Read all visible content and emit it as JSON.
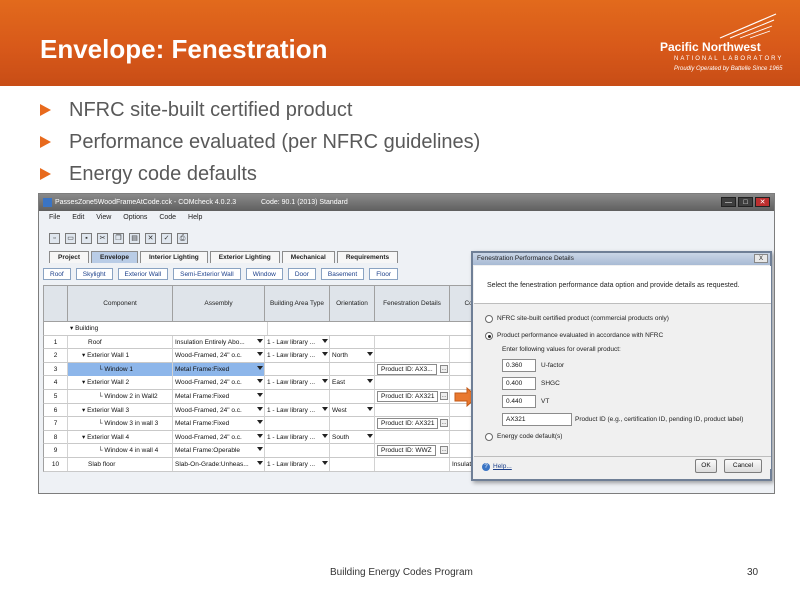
{
  "slide": {
    "title": "Envelope: Fenestration",
    "logo": {
      "name": "Pacific Northwest",
      "subtitle": "NATIONAL LABORATORY",
      "tagline": "Proudly Operated by Battelle Since 1965"
    },
    "bullets": [
      "NFRC site-built certified product",
      "Performance evaluated (per NFRC guidelines)",
      "Energy code defaults"
    ],
    "footer": "Building Energy Codes Program",
    "page_number": "30"
  },
  "app": {
    "window_title": "PassesZone5WoodFrameAtCode.cck - COMcheck 4.0.2.3",
    "code_label": "Code: 90.1 (2013) Standard",
    "window_buttons": [
      "—",
      "□",
      "✕"
    ],
    "menu": [
      "File",
      "Edit",
      "View",
      "Options",
      "Code",
      "Help"
    ],
    "toolbar_icons": [
      "new-icon",
      "open-icon",
      "save-icon",
      "cut-icon",
      "copy-icon",
      "paste-icon",
      "delete-icon",
      "check-icon",
      "print-icon"
    ],
    "tabs": [
      "Project",
      "Envelope",
      "Interior Lighting",
      "Exterior Lighting",
      "Mechanical",
      "Requirements"
    ],
    "active_tab": "Envelope",
    "subtabs": [
      "Roof",
      "Skylight",
      "Exterior Wall",
      "Semi-Exterior Wall",
      "Window",
      "Door",
      "Basement",
      "Floor"
    ],
    "table": {
      "headers": [
        "Component",
        "Assembly",
        "Building Area Type",
        "Orientation",
        "Fenestration Details",
        "Cons Det"
      ],
      "group_label": "Building",
      "rows": [
        {
          "num": "1",
          "component": "Roof",
          "assembly": "Insulation Entirely Abo...",
          "area": "1 - Law library ...",
          "orient": "",
          "fen": "",
          "sel": false
        },
        {
          "num": "2",
          "component": "Exterior Wall 1",
          "assembly": "Wood-Framed, 24\" o.c.",
          "area": "1 - Law library ...",
          "orient": "North",
          "fen": "",
          "sel": false
        },
        {
          "num": "3",
          "component": "Window 1",
          "assembly": "Metal Frame:Fixed",
          "area": "",
          "orient": "",
          "fen": "Product ID: AX3...",
          "sel": true
        },
        {
          "num": "4",
          "component": "Exterior Wall 2",
          "assembly": "Wood-Framed, 24\" o.c.",
          "area": "1 - Law library ...",
          "orient": "East",
          "fen": "",
          "sel": false
        },
        {
          "num": "5",
          "component": "Window 2 in Wall2",
          "assembly": "Metal Frame:Fixed",
          "area": "",
          "orient": "",
          "fen": "Product ID: AX321",
          "sel": false
        },
        {
          "num": "6",
          "component": "Exterior Wall 3",
          "assembly": "Wood-Framed, 24\" o.c.",
          "area": "1 - Law library ...",
          "orient": "West",
          "fen": "",
          "sel": false
        },
        {
          "num": "7",
          "component": "Window 3 in wall 3",
          "assembly": "Metal Frame:Fixed",
          "area": "",
          "orient": "",
          "fen": "Product ID: AX321",
          "sel": false
        },
        {
          "num": "8",
          "component": "Exterior Wall 4",
          "assembly": "Wood-Framed, 24\" o.c.",
          "area": "1 - Law library ...",
          "orient": "South",
          "fen": "",
          "sel": false
        },
        {
          "num": "9",
          "component": "Window 4 in wall 4",
          "assembly": "Metal Frame:Operable",
          "area": "",
          "orient": "",
          "fen": "Product ID: WWZ",
          "sel": false
        },
        {
          "num": "10",
          "component": "Slab floor",
          "assembly": "Slab-On-Grade:Unheas...",
          "area": "1 - Law library ...",
          "orient": "",
          "fen": "",
          "sel": false,
          "extra": "Insulat"
        }
      ]
    },
    "dialog": {
      "title": "Fenestration Performance Details",
      "close": "X",
      "instruction": "Select the fenestration performance data option and provide details as requested.",
      "options": [
        "NFRC site-built certified product (commercial products only)",
        "Product performance evaluated in accordance with NFRC",
        "Energy code default(s)"
      ],
      "selected_option": 1,
      "enter_label": "Enter following values for overall product:",
      "fields": {
        "u_factor_value": "0.360",
        "u_factor_label": "U-factor",
        "shgc_value": "0.400",
        "shgc_label": "SHGC",
        "vt_value": "0.440",
        "vt_label": "VT",
        "product_id_value": "AX321",
        "product_id_label": "Product ID (e.g., certification ID, pending ID, product label)"
      },
      "help_label": "Help...",
      "ok_label": "OK",
      "cancel_label": "Cancel"
    }
  }
}
